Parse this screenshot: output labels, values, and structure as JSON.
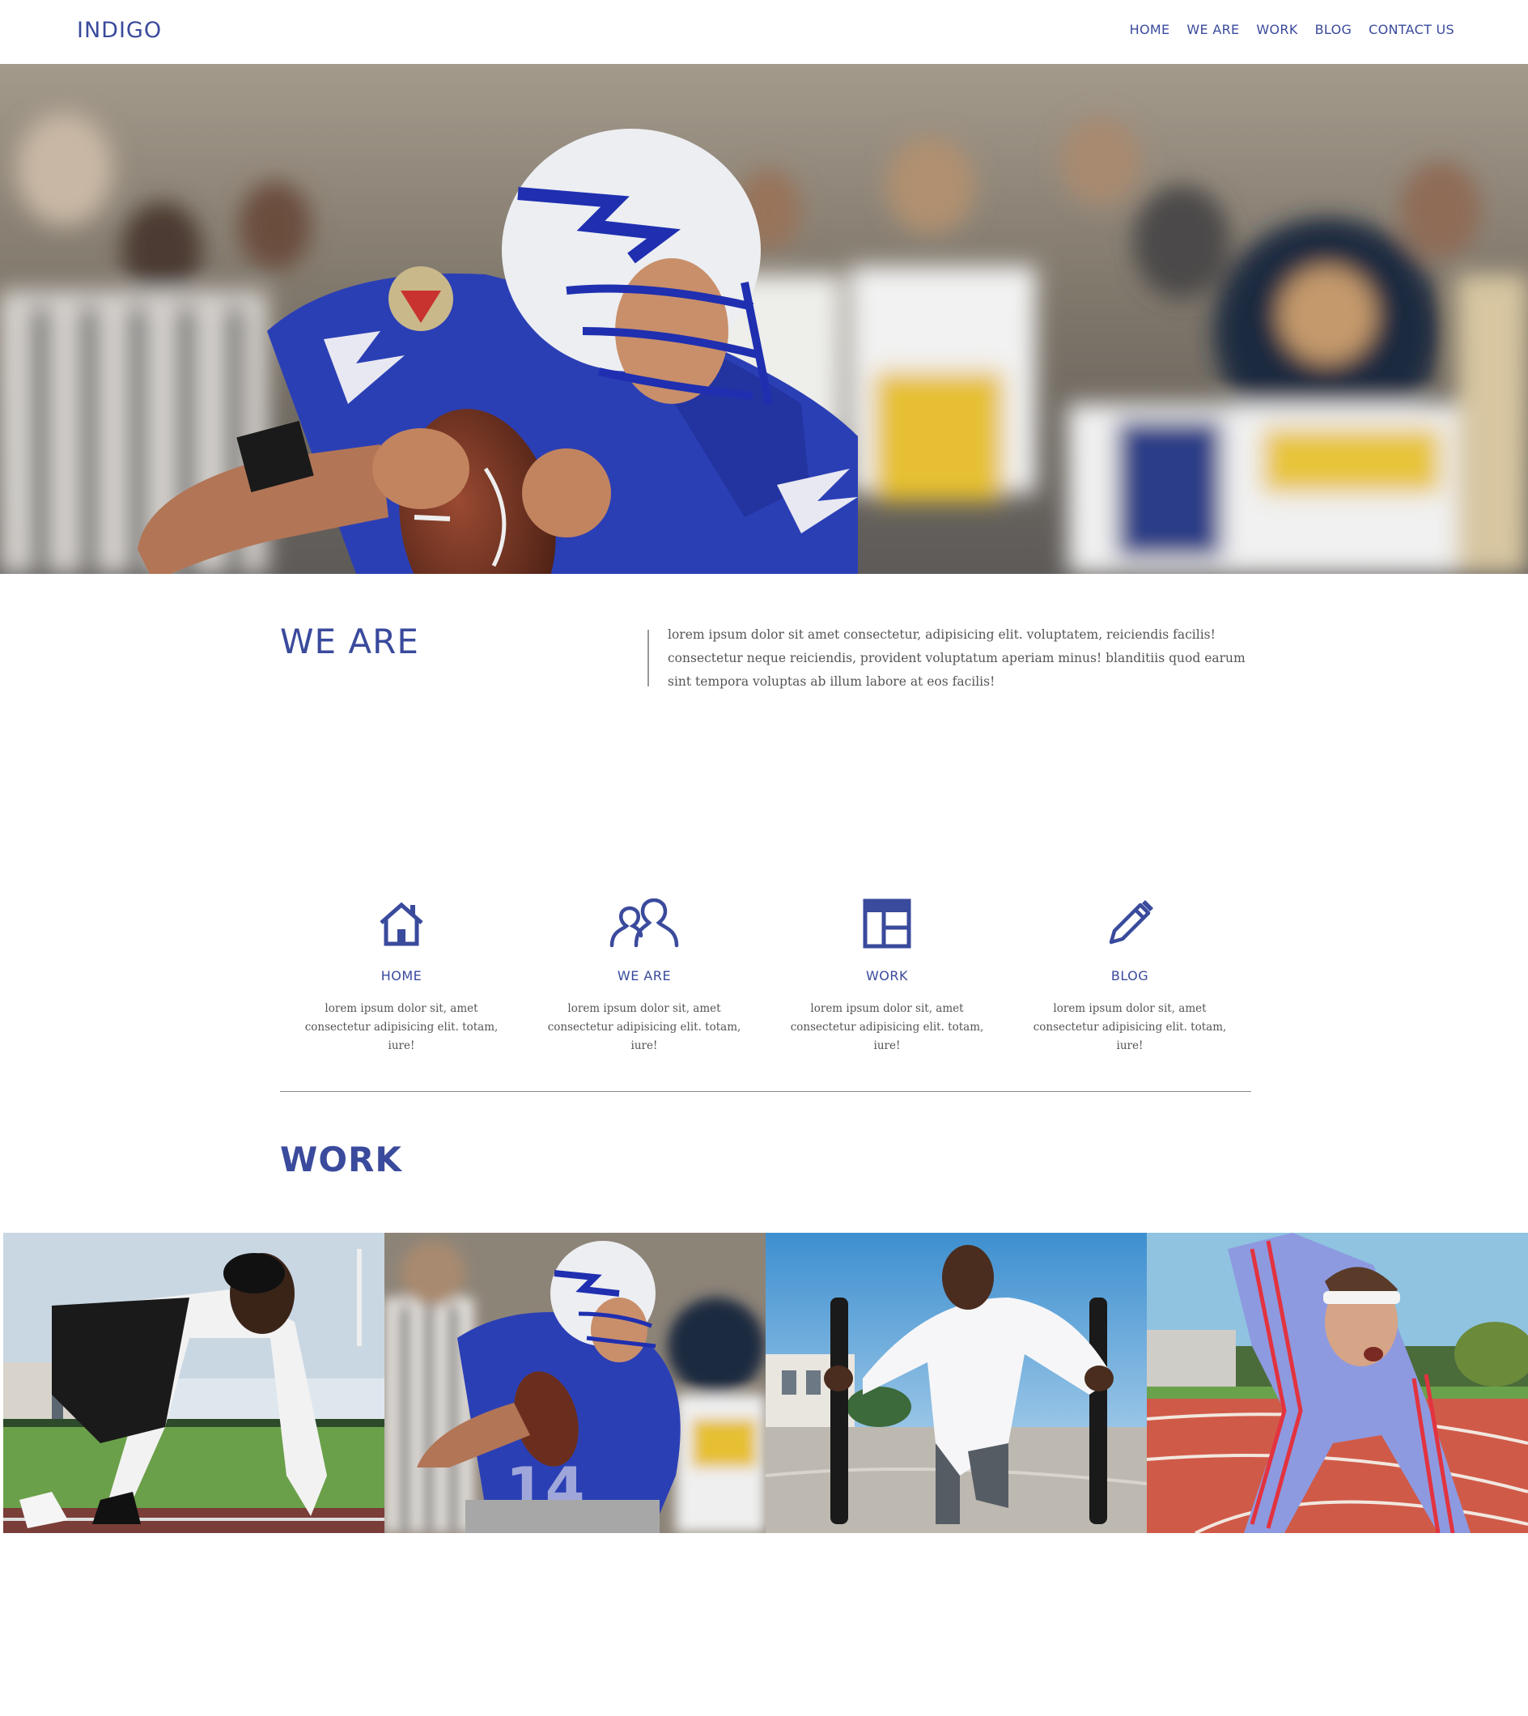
{
  "header": {
    "logo": "INDIGO",
    "nav": [
      "HOME",
      "WE ARE",
      "WORK",
      "BLOG",
      "CONTACT US"
    ]
  },
  "colors": {
    "brand": "#3a4a9c",
    "text": "#555555",
    "jersey_blue": "#2b3fb5"
  },
  "hero": {
    "image": "football-quarterback-photo"
  },
  "we_are": {
    "title": "WE ARE",
    "body": "lorem ipsum dolor sit amet consectetur, adipisicing elit. voluptatem, reiciendis facilis! consectetur neque reiciendis, provident voluptatum aperiam minus! blanditiis quod earum sint tempora voluptas ab illum labore at eos facilis!"
  },
  "features": [
    {
      "icon": "home-icon",
      "title": "HOME",
      "text": "lorem ipsum dolor sit, amet consectetur adipisicing elit. totam, iure!"
    },
    {
      "icon": "users-icon",
      "title": "WE ARE",
      "text": "lorem ipsum dolor sit, amet consectetur adipisicing elit. totam, iure!"
    },
    {
      "icon": "layout-icon",
      "title": "WORK",
      "text": "lorem ipsum dolor sit, amet consectetur adipisicing elit. totam, iure!"
    },
    {
      "icon": "pencil-icon",
      "title": "BLOG",
      "text": "lorem ipsum dolor sit, amet consectetur adipisicing elit. totam, iure!"
    }
  ],
  "work": {
    "title": "WORK",
    "gallery": [
      "sprinter-start-photo",
      "football-quarterback-photo",
      "sled-push-photo",
      "track-runner-photo"
    ]
  }
}
